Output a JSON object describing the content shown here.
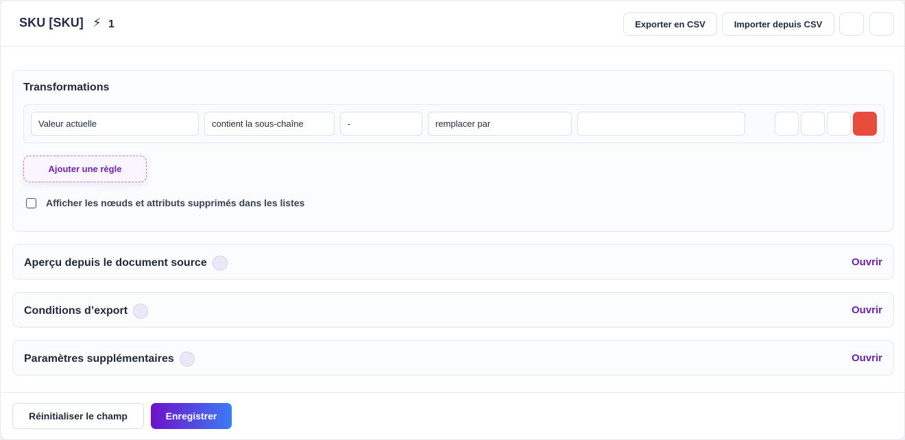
{
  "header": {
    "title": "SKU [SKU]",
    "bolt_icon": "⚡",
    "count": "1",
    "export_label": "Exporter en CSV",
    "import_label": "Importer depuis CSV"
  },
  "transformations": {
    "title": "Transformations",
    "rule": {
      "source": "Valeur actuelle",
      "operator": "contient la sous-chaîne",
      "search_value": "-",
      "action": "remplacer par",
      "replacement_value": ""
    },
    "add_rule_label": "Ajouter une règle",
    "show_deleted_label": "Afficher les nœuds et attributs supprimés dans les listes",
    "show_deleted_checked": false
  },
  "sections": [
    {
      "title": "Aperçu depuis le document source",
      "action": "Ouvrir"
    },
    {
      "title": "Conditions d’export",
      "action": "Ouvrir"
    },
    {
      "title": "Paramètres supplémentaires",
      "action": "Ouvrir"
    }
  ],
  "footer": {
    "reset_label": "Réinitialiser le champ",
    "save_label": "Enregistrer"
  },
  "colors": {
    "accent_purple": "#6b21a8",
    "delete_red": "#e74c3c",
    "save_gradient_start": "#6d12c9",
    "save_gradient_end": "#3b7bf5"
  }
}
